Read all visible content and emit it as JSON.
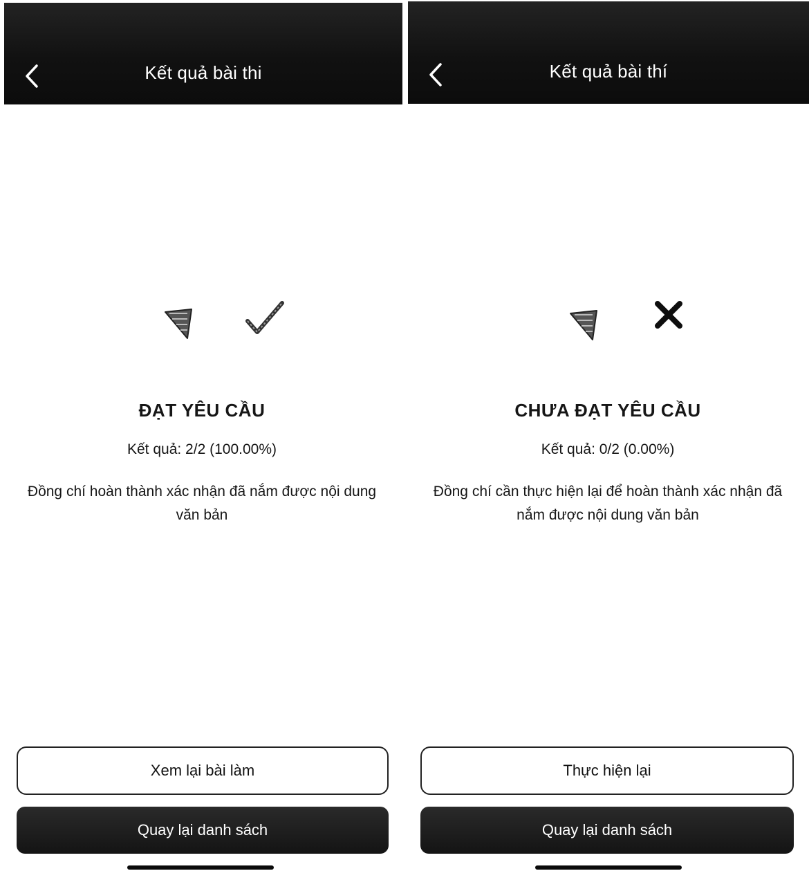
{
  "screens": [
    {
      "header": {
        "title": "Kết quả bài thi"
      },
      "result": {
        "status_title": "ĐẠT YÊU CẦU",
        "score_text": "Kết quả: 2/2 (100.00%)",
        "message": "Đồng chí hoàn thành xác nhận đã nắm được nội dung văn bản",
        "icons": [
          "triangle-flag-icon",
          "check-icon"
        ]
      },
      "buttons": {
        "secondary_label": "Xem lại bài làm",
        "primary_label": "Quay lại danh sách"
      }
    },
    {
      "header": {
        "title": "Kết quả bài thí"
      },
      "result": {
        "status_title": "CHƯA ĐẠT YÊU CẦU",
        "score_text": "Kết quả: 0/2 (0.00%)",
        "message": "Đồng chí cần thực hiện lại để hoàn thành xác nhận đã nắm được nội dung văn bản",
        "icons": [
          "triangle-flag-icon",
          "close-icon"
        ]
      },
      "buttons": {
        "secondary_label": "Thực hiện lại",
        "primary_label": "Quay lại danh sách"
      }
    }
  ],
  "colors": {
    "header_bg": "#111111",
    "header_text": "#ffffff",
    "body_text": "#161616",
    "primary_button_bg": "#1a1a1a",
    "primary_button_text": "#ffffff",
    "outline_button_border": "#222222"
  }
}
